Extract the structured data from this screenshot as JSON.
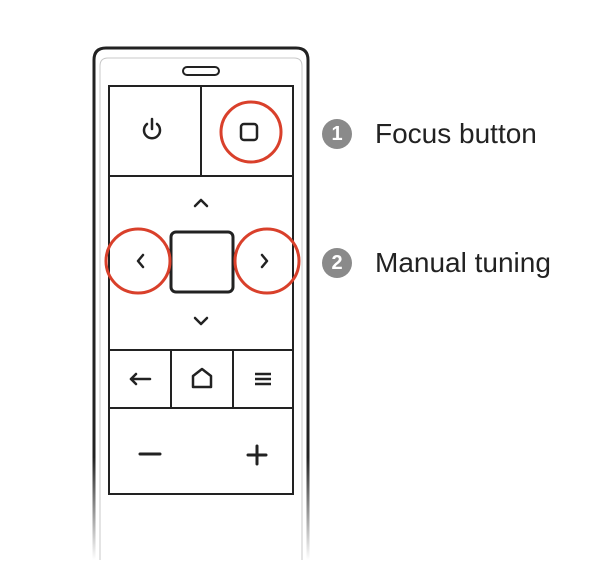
{
  "callouts": [
    {
      "number": "1",
      "label": "Focus button"
    },
    {
      "number": "2",
      "label": "Manual tuning"
    }
  ],
  "remote": {
    "buttons": [
      {
        "name": "power-button",
        "icon": "power-icon"
      },
      {
        "name": "focus-button",
        "icon": "square-icon",
        "highlighted": true
      },
      {
        "name": "up-button",
        "icon": "chevron-up-icon"
      },
      {
        "name": "left-button",
        "icon": "chevron-left-icon",
        "highlighted": true
      },
      {
        "name": "center-ok-button",
        "icon": "square-icon"
      },
      {
        "name": "right-button",
        "icon": "chevron-right-icon",
        "highlighted": true
      },
      {
        "name": "down-button",
        "icon": "chevron-down-icon"
      },
      {
        "name": "back-button",
        "icon": "back-arrow-icon"
      },
      {
        "name": "home-button",
        "icon": "home-icon"
      },
      {
        "name": "menu-button",
        "icon": "menu-icon"
      },
      {
        "name": "minus-button",
        "icon": "minus-icon"
      },
      {
        "name": "plus-button",
        "icon": "plus-icon"
      }
    ]
  },
  "colors": {
    "outline": "#222222",
    "highlight": "#d9402b",
    "badge": "#8a8a8a"
  }
}
